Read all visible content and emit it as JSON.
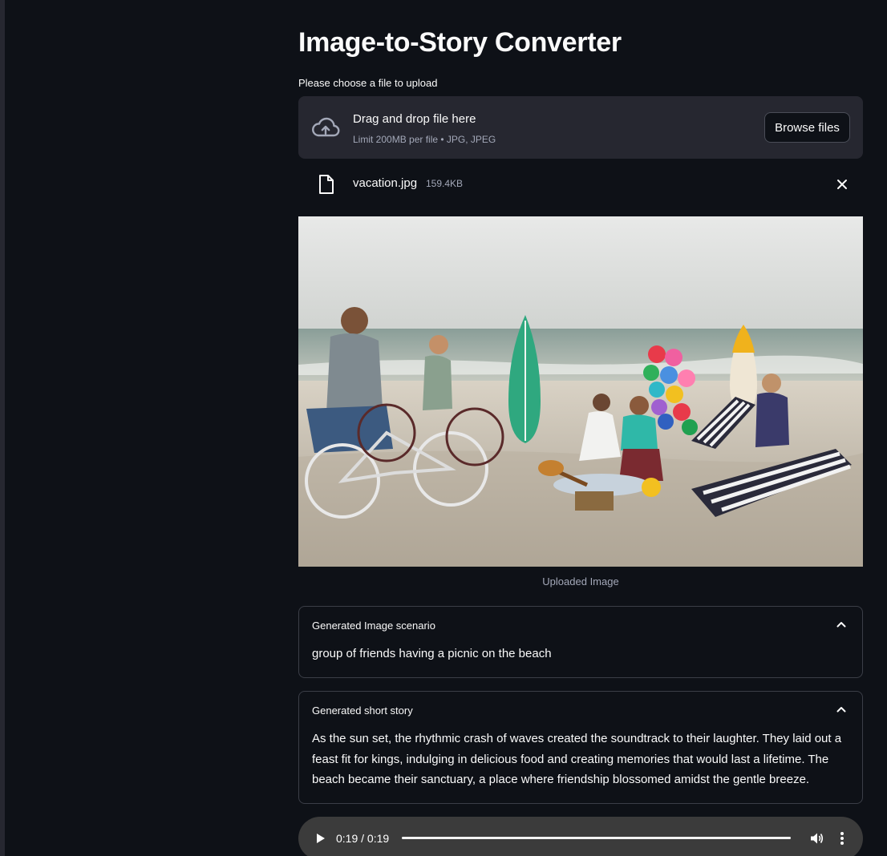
{
  "header": {
    "title": "Image-to-Story Converter"
  },
  "uploader": {
    "label": "Please choose a file to upload",
    "drop_title": "Drag and drop file here",
    "limit_text": "Limit 200MB per file • JPG, JPEG",
    "browse_label": "Browse files",
    "upload_icon": "cloud-upload-icon"
  },
  "file": {
    "name": "vacation.jpg",
    "size": "159.4KB",
    "icon": "file-icon",
    "remove_icon": "close-icon"
  },
  "image": {
    "caption": "Uploaded Image"
  },
  "scenario": {
    "title": "Generated Image scenario",
    "text": "group of friends having a picnic on the beach",
    "expanded": true
  },
  "story": {
    "title": "Generated short story",
    "text": "As the sun set, the rhythmic crash of waves created the soundtrack to their laughter. They laid out a feast fit for kings, indulging in delicious food and creating memories that would last a lifetime. The beach became their sanctuary, a place where friendship blossomed amidst the gentle breeze.",
    "expanded": true
  },
  "audio": {
    "time": "0:19 / 0:19",
    "progress": 1.0
  },
  "colors": {
    "background": "#0e1117",
    "panel": "#262730",
    "text": "#fafafa",
    "muted": "#a3a8b8",
    "border": "#3b3e47",
    "player": "#3b3b3b"
  }
}
